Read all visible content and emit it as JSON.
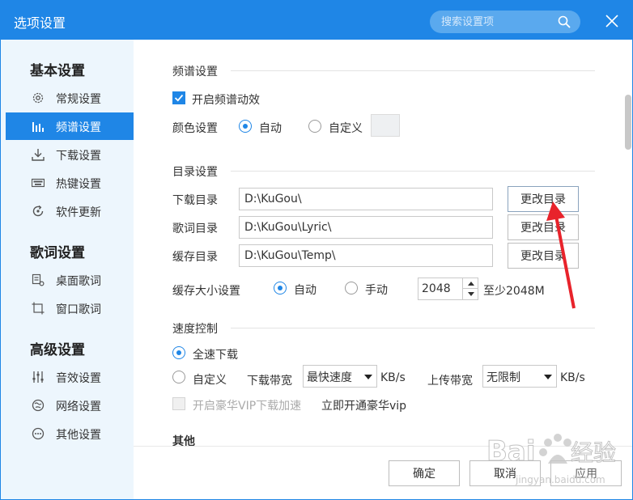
{
  "window": {
    "title": "选项设置"
  },
  "search": {
    "placeholder": "搜索设置项"
  },
  "sidebar": {
    "groups": [
      {
        "title": "基本设置"
      },
      {
        "title": "歌词设置"
      },
      {
        "title": "高级设置"
      }
    ],
    "items": [
      {
        "label": "常规设置",
        "icon": "gear-icon"
      },
      {
        "label": "频谱设置",
        "icon": "spectrum-icon",
        "active": true
      },
      {
        "label": "下载设置",
        "icon": "download-icon"
      },
      {
        "label": "热键设置",
        "icon": "keyboard-icon"
      },
      {
        "label": "软件更新",
        "icon": "update-icon"
      },
      {
        "label": "桌面歌词",
        "icon": "desktop-lyric-icon"
      },
      {
        "label": "窗口歌词",
        "icon": "window-lyric-icon"
      },
      {
        "label": "音效设置",
        "icon": "equalizer-icon"
      },
      {
        "label": "网络设置",
        "icon": "network-icon"
      },
      {
        "label": "其他设置",
        "icon": "more-icon"
      }
    ]
  },
  "spectrum": {
    "title": "频谱设置",
    "enable_label": "开启频谱动效",
    "enable_checked": true,
    "color_label": "颜色设置",
    "auto_label": "自动",
    "custom_label": "自定义",
    "color_mode": "auto"
  },
  "dirs": {
    "title": "目录设置",
    "rows": [
      {
        "label": "下载目录",
        "value": "D:\\KuGou\\",
        "button": "更改目录"
      },
      {
        "label": "歌词目录",
        "value": "D:\\KuGou\\Lyric\\",
        "button": "更改目录"
      },
      {
        "label": "缓存目录",
        "value": "D:\\KuGou\\Temp\\",
        "button": "更改目录"
      }
    ],
    "cache_size_label": "缓存大小设置",
    "auto_label": "自动",
    "manual_label": "手动",
    "cache_mode": "auto",
    "cache_size_value": "2048",
    "cache_min_text": "至少2048M"
  },
  "speed": {
    "title": "速度控制",
    "full_speed_label": "全速下载",
    "custom_label": "自定义",
    "mode": "full",
    "download_bw_label": "下载带宽",
    "download_bw_value": "最快速度",
    "unit": "KB/s",
    "upload_bw_label": "上传带宽",
    "upload_bw_value": "无限制",
    "vip_label": "开启豪华VIP下载加速",
    "vip_link": "立即开通豪华vip"
  },
  "other": {
    "title": "其他"
  },
  "footer": {
    "ok": "确定",
    "cancel": "取消",
    "apply": "应用"
  },
  "watermark": {
    "brand": "Bai",
    "suffix": "经验",
    "url": "jingyan.baidu.com"
  },
  "colors": {
    "accent": "#1f86e6",
    "sidebar_bg": "#edf6fd",
    "annotation": "#e8232b"
  }
}
